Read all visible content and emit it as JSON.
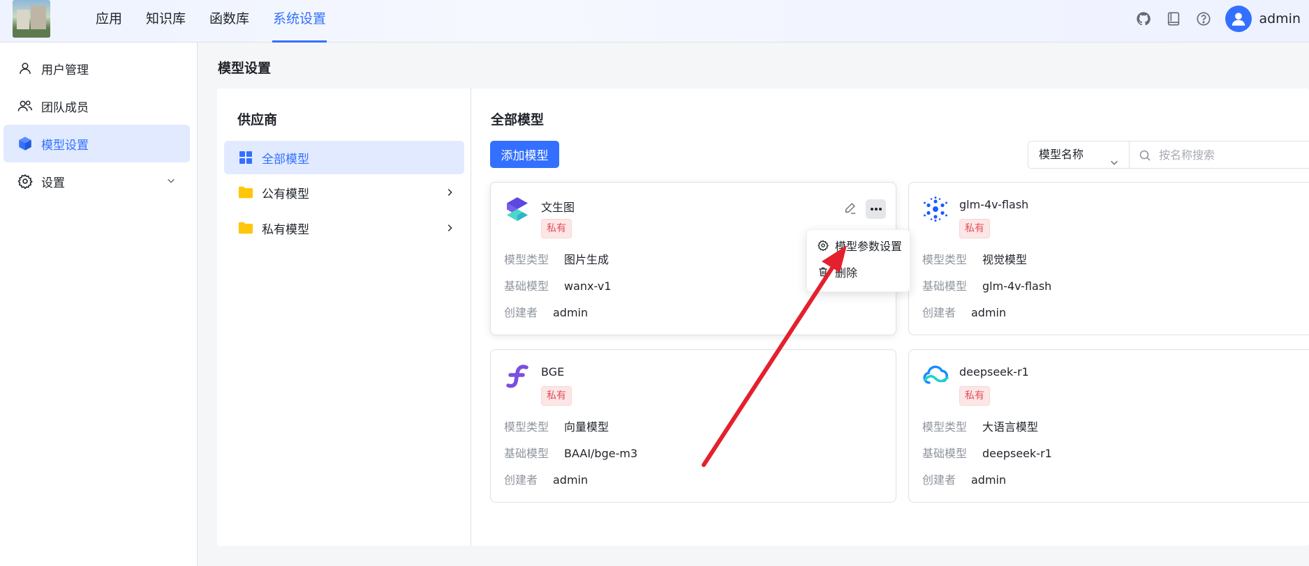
{
  "header": {
    "nav": [
      {
        "label": "应用"
      },
      {
        "label": "知识库"
      },
      {
        "label": "函数库"
      },
      {
        "label": "系统设置"
      }
    ],
    "active_nav": "系统设置",
    "icons": [
      "github-icon",
      "book-icon",
      "help-icon"
    ],
    "user": "admin"
  },
  "sidebar": {
    "items": [
      {
        "label": "用户管理",
        "icon": "user-icon"
      },
      {
        "label": "团队成员",
        "icon": "team-icon"
      },
      {
        "label": "模型设置",
        "icon": "cube-icon"
      },
      {
        "label": "设置",
        "icon": "gear-icon"
      }
    ],
    "active": "模型设置"
  },
  "page": {
    "title": "模型设置"
  },
  "provider": {
    "title": "供应商",
    "items": [
      {
        "label": "全部模型"
      },
      {
        "label": "公有模型"
      },
      {
        "label": "私有模型"
      }
    ],
    "active": "全部模型"
  },
  "models": {
    "title": "全部模型",
    "add_label": "添加模型",
    "filter_select": "模型名称",
    "search_placeholder": "按名称搜索",
    "field_labels": {
      "type": "模型类型",
      "base": "基础模型",
      "creator": "创建者"
    },
    "cards": [
      {
        "name": "文生图",
        "tag": "私有",
        "type": "图片生成",
        "base": "wanx-v1",
        "creator": "admin",
        "icon": "wanx-logo-icon"
      },
      {
        "name": "glm-4v-flash",
        "tag": "私有",
        "type": "视觉模型",
        "base": "glm-4v-flash",
        "creator": "admin",
        "icon": "zhipu-logo-icon"
      },
      {
        "name": "BGE",
        "tag": "私有",
        "type": "向量模型",
        "base": "BAAI/bge-m3",
        "creator": "admin",
        "icon": "bge-logo-icon"
      },
      {
        "name": "deepseek-r1",
        "tag": "私有",
        "type": "大语言模型",
        "base": "deepseek-r1",
        "creator": "admin",
        "icon": "cloud-logo-icon"
      }
    ]
  },
  "dropdown_menu": {
    "items": [
      {
        "label": "模型参数设置",
        "icon": "gear-icon"
      },
      {
        "label": "删除",
        "icon": "trash-icon"
      }
    ]
  },
  "colors": {
    "accent": "#3370ff",
    "tag_bg": "#fde6e6",
    "tag_text": "#e34d59",
    "arrow": "#e4202e"
  }
}
